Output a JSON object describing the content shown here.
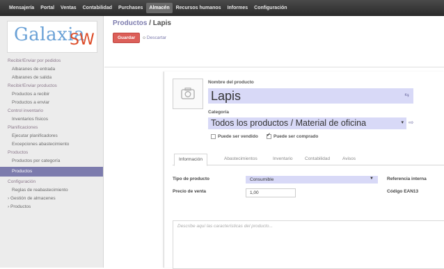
{
  "topnav": {
    "items": [
      "Mensajería",
      "Portal",
      "Ventas",
      "Contabilidad",
      "Purchases",
      "Almacén",
      "Recursos humanos",
      "Informes",
      "Configuración"
    ],
    "active_index": 5
  },
  "logo": {
    "word1": "Galaxia",
    "word2": "SW"
  },
  "sidebar": {
    "sec1": "Recibir/Enviar por pedidos",
    "sec1_items": [
      "Albaranes de entrada",
      "Albaranes de salida"
    ],
    "sec2": "Recibir/Enviar productos",
    "sec2_items": [
      "Productos a recibir",
      "Productos a enviar"
    ],
    "sec3": "Control inventario",
    "sec3_items": [
      "Inventarios físicos"
    ],
    "sec4": "Planificaciones",
    "sec4_items": [
      "Ejecutar planificadores",
      "Excepciones abastecimiento"
    ],
    "sec5": "Productos",
    "sec5_items": [
      "Productos por categoría",
      "Productos"
    ],
    "sec6": "Configuración",
    "sec6_items": [
      "Reglas de reabastecimiento"
    ],
    "sec6_expand": [
      "Gestión de almacenes",
      "Productos"
    ]
  },
  "breadcrumb": {
    "parent": "Productos",
    "sep": " / ",
    "current": "Lapis"
  },
  "actions": {
    "save": "Guardar",
    "or": "o",
    "discard": "Descartar"
  },
  "form": {
    "name_label": "Nombre del producto",
    "name_value": "Lapis",
    "translate_icon": "translate-icon",
    "category_label": "Categoría",
    "category_value": "Todos los productos / Material de oficina",
    "can_sell_label": "Puede ser vendido",
    "can_sell": false,
    "can_buy_label": "Puede ser comprado",
    "can_buy": true,
    "tabs": [
      "Información",
      "Abastecimientos",
      "Inventario",
      "Contabilidad",
      "Avisos"
    ],
    "active_tab": 0,
    "type_label": "Tipo de producto",
    "type_value": "Consumible",
    "price_label": "Precio de venta",
    "price_value": "1,00",
    "ref_label": "Referencia interna",
    "ean_label": "Código EAN13",
    "desc_placeholder": "Describe aquí las características del producto..."
  }
}
